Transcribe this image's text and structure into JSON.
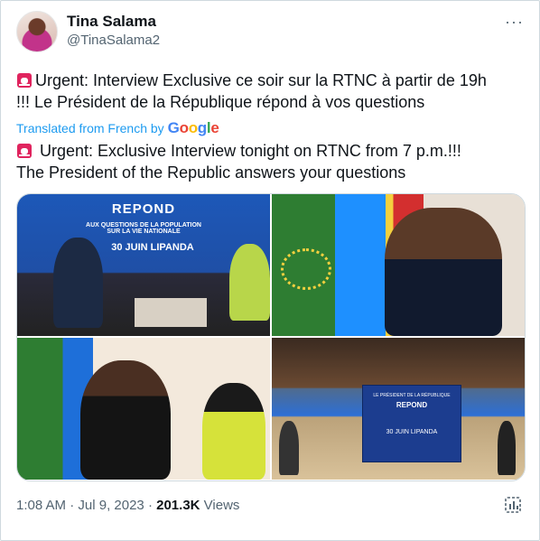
{
  "author": {
    "name": "Tina Salama",
    "handle": "@TinaSalama2"
  },
  "tweet": {
    "line1": "Urgent: Interview Exclusive ce soir sur la RTNC à partir de 19h",
    "line2": "!!! Le Président de la République répond à vos questions",
    "translated_label": "Translated from French by",
    "translation_line1": " Urgent: Exclusive Interview tonight on RTNC from 7 p.m.!!!",
    "translation_line2": "The President of the Republic answers your questions"
  },
  "media": {
    "photo1": {
      "banner_title": "REPOND",
      "banner_sub1": "AUX QUESTIONS DE LA POPULATION",
      "banner_sub2": "SUR LA VIE NATIONALE",
      "banner_date": "30 JUIN LIPANDA"
    },
    "photo4": {
      "sign_title": "LE PRÉSIDENT DE LA RÉPUBLIQUE",
      "sign_sub": "REPOND",
      "sign_date": "30 JUIN LIPANDA"
    }
  },
  "meta": {
    "time": "1:08 AM",
    "date": "Jul 9, 2023",
    "views_count": "201.3K",
    "views_label": "Views"
  },
  "colors": {
    "link": "#1d9bf0",
    "secondary_text": "#536471",
    "siren": "#e0245e"
  }
}
